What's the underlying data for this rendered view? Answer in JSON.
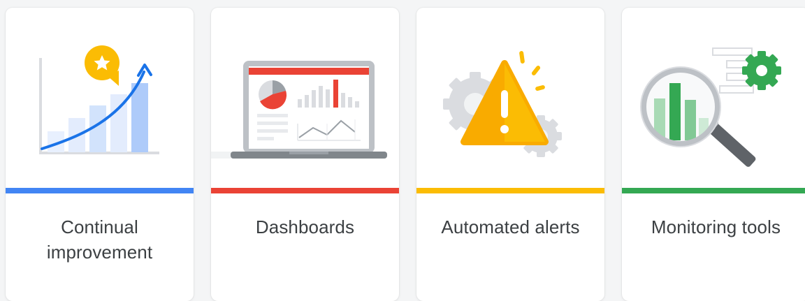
{
  "cards": [
    {
      "label": "Continual improvement",
      "icon": "growth-chart-icon",
      "accent": "#4285f4"
    },
    {
      "label": "Dashboards",
      "icon": "laptop-dashboard-icon",
      "accent": "#ea4335"
    },
    {
      "label": "Automated alerts",
      "icon": "warning-gears-icon",
      "accent": "#fbbc04"
    },
    {
      "label": "Monitoring tools",
      "icon": "magnifier-chart-icon",
      "accent": "#34a853"
    }
  ]
}
